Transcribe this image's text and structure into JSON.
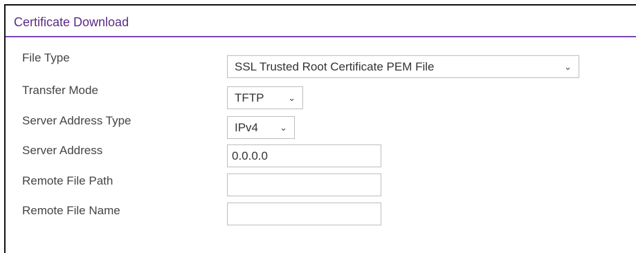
{
  "panel": {
    "title": "Certificate Download"
  },
  "form": {
    "file_type": {
      "label": "File Type",
      "value": "SSL Trusted Root Certificate PEM File"
    },
    "transfer_mode": {
      "label": "Transfer Mode",
      "value": "TFTP"
    },
    "server_address_type": {
      "label": "Server Address Type",
      "value": "IPv4"
    },
    "server_address": {
      "label": "Server Address",
      "value": "0.0.0.0"
    },
    "remote_file_path": {
      "label": "Remote File Path",
      "value": ""
    },
    "remote_file_name": {
      "label": "Remote File Name",
      "value": ""
    }
  },
  "icons": {
    "dropdown": "chevron-down-icon"
  },
  "colors": {
    "accent": "#7a44b3",
    "title_text": "#5b2a86"
  }
}
